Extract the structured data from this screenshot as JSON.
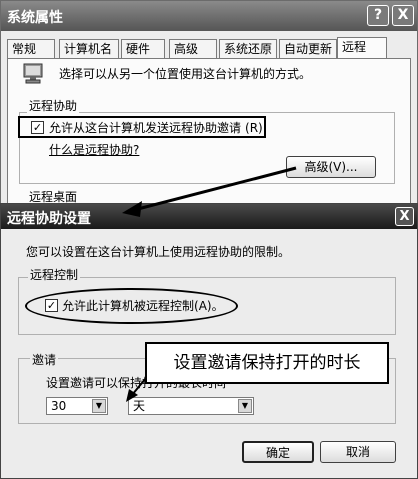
{
  "system_properties": {
    "title": "系统属性",
    "help_button": "?",
    "close_button": "X",
    "tabs": [
      "常规",
      "计算机名",
      "硬件",
      "高级",
      "系统还原",
      "自动更新",
      "远程"
    ],
    "active_tab": "远程",
    "description": "选择可以从另一个位置使用这台计算机的方式。",
    "remote_assistance_group": "远程协助",
    "allow_invitations_checkbox": "允许从这台计算机发送远程协助邀请",
    "allow_invitations_accel": "(R)",
    "what_is_link": "什么是远程协助?",
    "advanced_button": "高级(V)...",
    "remote_desktop_group": "远程桌面"
  },
  "remote_assistance_settings": {
    "title": "远程协助设置",
    "close_button": "X",
    "description": "您可以设置在这台计算机上使用远程协助的限制。",
    "remote_control_group": "远程控制",
    "allow_remote_control_checkbox": "允许此计算机被远程控制",
    "allow_remote_control_accel": "(A)。",
    "invitation_group": "邀请",
    "invitation_label_visible": "设置邀请可以保持",
    "invitation_label_partial": "打开的最长时间",
    "duration_value": "30",
    "duration_unit": "天",
    "ok_button": "确定",
    "cancel_button": "取消"
  },
  "annotation": {
    "callout_text": "设置邀请保持打开的时长"
  },
  "icons": {
    "computer": "computer-icon",
    "checked": "checkmark-icon",
    "dropdown": "chevron-down-icon"
  }
}
